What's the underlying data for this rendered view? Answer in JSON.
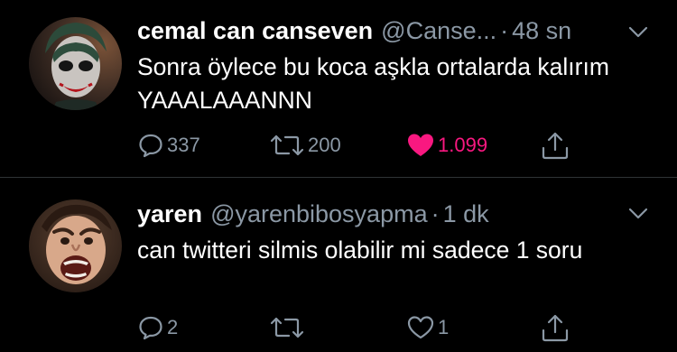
{
  "colors": {
    "background": "#000000",
    "text_primary": "#ffffff",
    "text_secondary": "#8b98a5",
    "like_active": "#f91880",
    "divider": "#2f3336"
  },
  "tweets": [
    {
      "display_name": "cemal can canseven",
      "handle": "@Canse...",
      "separator": "·",
      "time": "48 sn",
      "text": "Sonra öylece bu koca aşkla ortalarda kalırım YAAALAAANNN",
      "replies": "337",
      "retweets": "200",
      "likes": "1.099",
      "liked": true,
      "avatar_icon": "avatar-joker-face"
    },
    {
      "display_name": "yaren",
      "handle": "@yarenbibosyapma",
      "separator": "·",
      "time": "1 dk",
      "text": "can twitteri silmis olabilir mi sadece 1 soru",
      "replies": "2",
      "retweets": "",
      "likes": "1",
      "liked": false,
      "avatar_icon": "avatar-screaming-face"
    }
  ]
}
